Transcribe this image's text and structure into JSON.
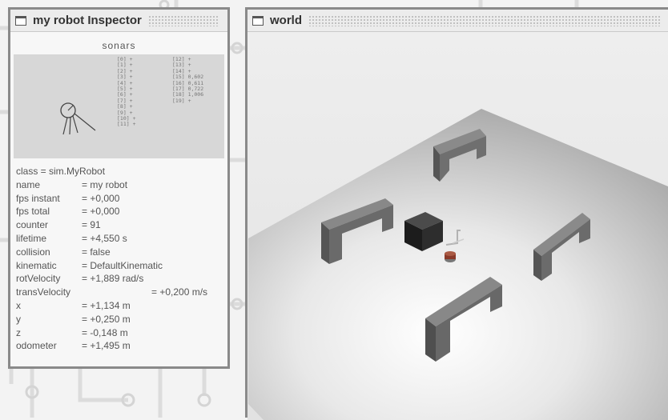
{
  "inspector": {
    "title": "my robot Inspector",
    "sonars_label": "sonars",
    "sonars_left": [
      "[0] +",
      "[1] +",
      "[2] +",
      "[3] +",
      "[4] +",
      "[5] +",
      "[6] +",
      "[7] +",
      "[8] +",
      "[9] +",
      "[10] +",
      "[11] +"
    ],
    "sonars_right": [
      "[12] +",
      "[13] +",
      "[14] +",
      "[15] 0,602",
      "[16] 0,611",
      "[17] 0,722",
      "[18] 1,006",
      "[19] +"
    ],
    "class_line": "class = sim.MyRobot",
    "props": [
      {
        "k": "name",
        "v": "= my robot"
      },
      {
        "k": "fps instant",
        "v": "= +0,000"
      },
      {
        "k": "fps total",
        "v": "= +0,000"
      },
      {
        "k": "counter",
        "v": "= 91"
      },
      {
        "k": "lifetime",
        "v": "= +4,550 s"
      },
      {
        "k": "collision",
        "v": "= false"
      },
      {
        "k": "kinematic",
        "v": "= DefaultKinematic"
      },
      {
        "k": "rotVelocity",
        "v": "= +1,889 rad/s"
      },
      {
        "k": "transVelocity",
        "v": "= +0,200 m/s"
      },
      {
        "k": "x",
        "v": "= +1,134 m"
      },
      {
        "k": "y",
        "v": "= +0,250 m"
      },
      {
        "k": "z",
        "v": "= -0,148 m"
      },
      {
        "k": "odometer",
        "v": "= +1,495 m"
      }
    ]
  },
  "world": {
    "title": "world"
  }
}
